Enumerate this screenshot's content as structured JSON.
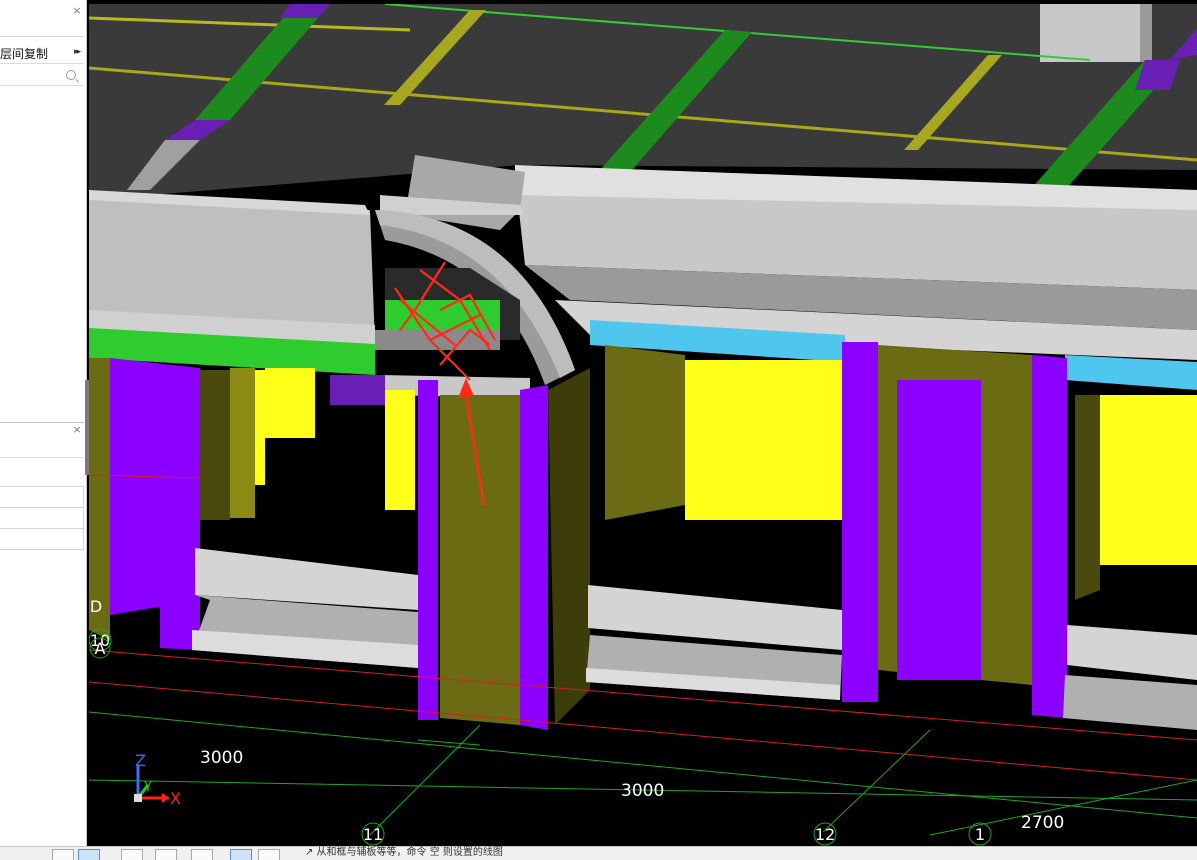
{
  "panel_top": {
    "close_glyph": "×",
    "command_label": "层间复制",
    "expand_glyph": "▸▸",
    "search_icon": "search-icon"
  },
  "panel_bottom": {
    "close_glyph": "×"
  },
  "viewport": {
    "dimensions": [
      "3000",
      "3000",
      "2700"
    ],
    "axis_bubbles": [
      "11",
      "12",
      "1"
    ],
    "side_labels": [
      "10",
      "A",
      "D"
    ],
    "axes": {
      "x": "X",
      "y": "Y",
      "z": "Z"
    }
  },
  "colors": {
    "column_purple": "#8b00ff",
    "beam_green": "#2ecc2e",
    "wall_olive": "#6b6b14",
    "wall_yellow": "#ffff1a",
    "slab_gray": "#3c3c3c",
    "annotation_red": "#ff2a1a",
    "cyan_beam": "#4fc6ee"
  },
  "toolbar": {
    "buttons": [
      "select-tool-icon",
      "window-select-icon",
      "cross-select-icon",
      "line-tool-icon",
      "rect-tool-icon",
      "save-view-icon",
      "angle-tool-icon"
    ]
  },
  "status": {
    "hint": "↗ 从和框与辅板等等，命令 空 则设置的线图"
  }
}
